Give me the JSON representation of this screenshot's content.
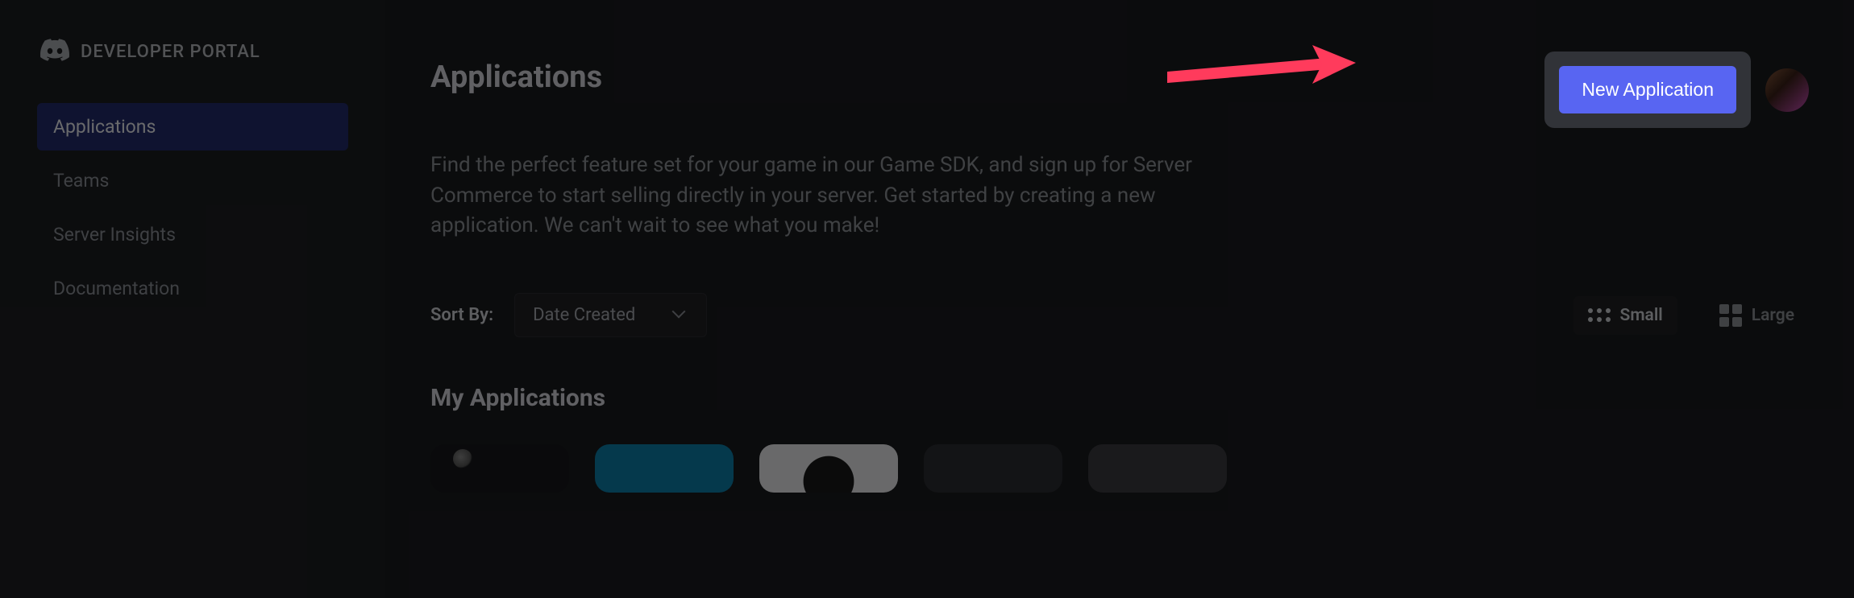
{
  "brand": {
    "title": "DEVELOPER PORTAL",
    "icon": "discord-icon"
  },
  "sidebar": {
    "items": [
      {
        "label": "Applications",
        "active": true
      },
      {
        "label": "Teams",
        "active": false
      },
      {
        "label": "Server Insights",
        "active": false
      },
      {
        "label": "Documentation",
        "active": false
      }
    ]
  },
  "header": {
    "title": "Applications",
    "new_button_label": "New Application"
  },
  "description": "Find the perfect feature set for your game in our Game SDK, and sign up for Server Commerce to start selling directly in your server. Get started by creating a new application. We can't wait to see what you make!",
  "sort": {
    "label": "Sort By:",
    "selected": "Date Created"
  },
  "view": {
    "small_label": "Small",
    "large_label": "Large"
  },
  "section": {
    "my_applications_title": "My Applications"
  },
  "annotation": {
    "arrow_color": "#ff3b5c"
  }
}
